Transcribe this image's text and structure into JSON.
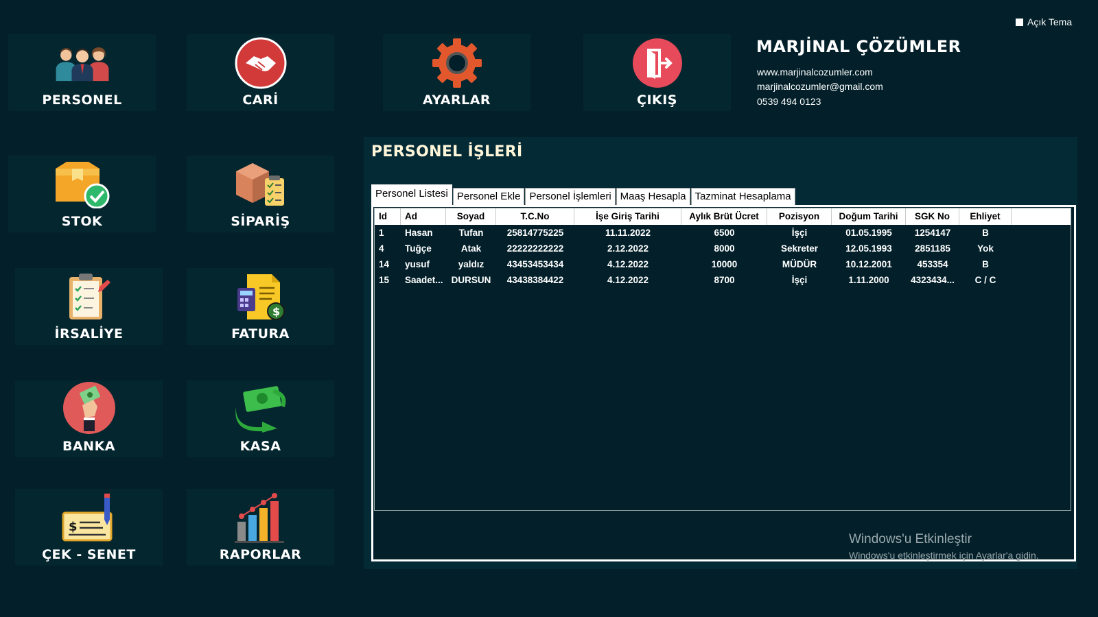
{
  "theme_toggle": {
    "label": "Açık Tema"
  },
  "brand": {
    "title": "MARJİNAL ÇÖZÜMLER",
    "website": "www.marjinalcozumler.com",
    "email": "marjinalcozumler@gmail.com",
    "phone": "0539 494 0123"
  },
  "menu": {
    "personel": "PERSONEL",
    "cari": "CARİ",
    "ayarlar": "AYARLAR",
    "cikis": "ÇIKIŞ",
    "stok": "STOK",
    "siparis": "SİPARİŞ",
    "irsaliye": "İRSALİYE",
    "fatura": "FATURA",
    "banka": "BANKA",
    "kasa": "KASA",
    "cek_senet": "ÇEK - SENET",
    "raporlar": "RAPORLAR"
  },
  "icons": {
    "personel": "people-group-icon",
    "cari": "handshake-icon",
    "ayarlar": "gear-icon",
    "cikis": "exit-door-icon",
    "stok": "box-check-icon",
    "siparis": "package-checklist-icon",
    "irsaliye": "clipboard-checklist-icon",
    "fatura": "invoice-calculator-icon",
    "banka": "hand-money-icon",
    "kasa": "cash-transfer-icon",
    "cek_senet": "cheque-pen-icon",
    "raporlar": "bar-chart-icon"
  },
  "section": {
    "title": "PERSONEL İŞLERİ"
  },
  "tabs": [
    "Personel Listesi",
    "Personel Ekle",
    "Personel İşlemleri",
    "Maaş Hesapla",
    "Tazminat Hesaplama"
  ],
  "table": {
    "headers": [
      "Id",
      "Ad",
      "Soyad",
      "T.C.No",
      "İşe Giriş Tarihi",
      "Aylık Brüt Ücret",
      "Pozisyon",
      "Doğum Tarihi",
      "SGK No",
      "Ehliyet"
    ],
    "rows": [
      [
        "1",
        "Hasan",
        "Tufan",
        "25814775225",
        "11.11.2022",
        "6500",
        "İşçi",
        "01.05.1995",
        "1254147",
        "B"
      ],
      [
        "4",
        "Tuğçe",
        "Atak",
        "22222222222",
        "2.12.2022",
        "8000",
        "Sekreter",
        "12.05.1993",
        "2851185",
        "Yok"
      ],
      [
        "14",
        "yusuf",
        "yaldız",
        "43453453434",
        "4.12.2022",
        "10000",
        "MÜDÜR",
        "10.12.2001",
        "453354",
        "B"
      ],
      [
        "15",
        "Saadet...",
        "DURSUN",
        "43438384422",
        "4.12.2022",
        "8700",
        "İşçi",
        "1.11.2000",
        "4323434...",
        "C / C"
      ]
    ]
  },
  "watermark": {
    "title": "Windows'u Etkinleştir",
    "subtitle": "Windows'u etkinleştirmek için Ayarlar'a gidin."
  },
  "colors": {
    "background": "#03202a",
    "tile": "#04262f",
    "accent_red": "#e05a5a",
    "title_cream": "#fff6da"
  }
}
